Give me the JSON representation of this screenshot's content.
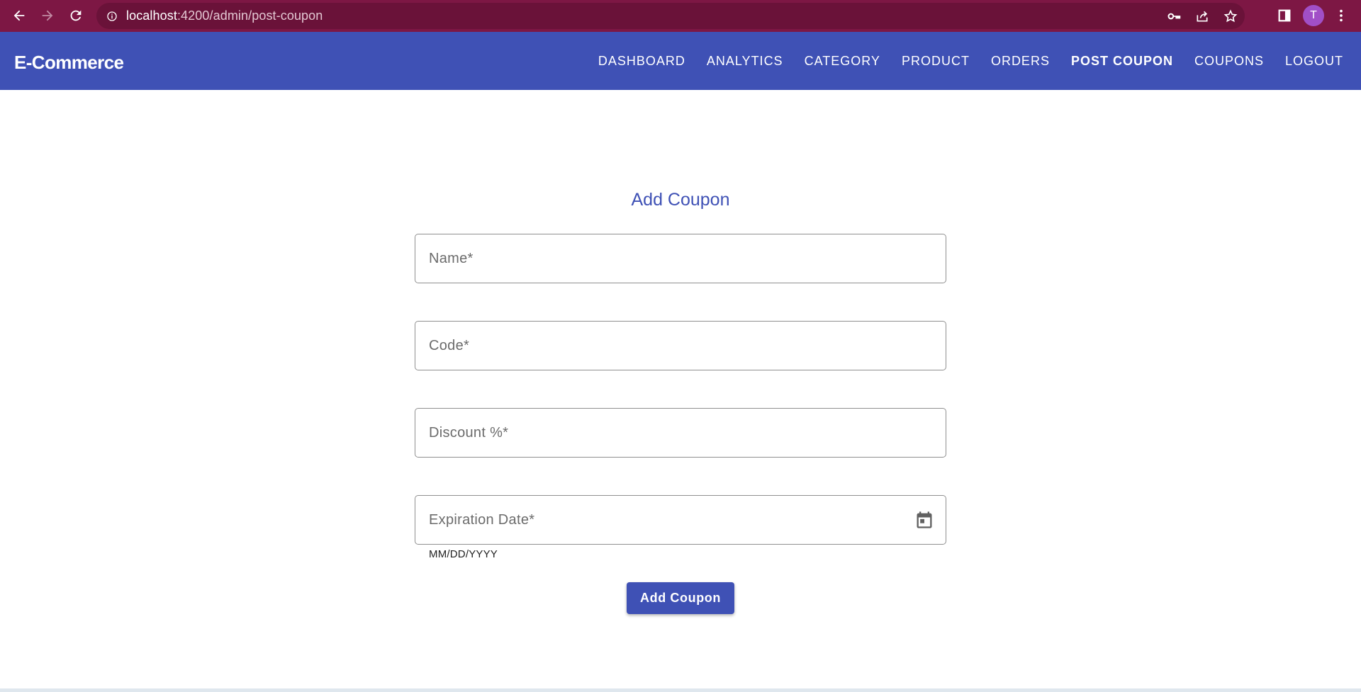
{
  "browser": {
    "url_host": "localhost",
    "url_path": ":4200/admin/post-coupon",
    "profile_initial": "T"
  },
  "app": {
    "brand": "E-Commerce",
    "nav": [
      {
        "label": "DASHBOARD"
      },
      {
        "label": "ANALYTICS"
      },
      {
        "label": "CATEGORY"
      },
      {
        "label": "PRODUCT"
      },
      {
        "label": "ORDERS"
      },
      {
        "label": "POST COUPON",
        "active": true
      },
      {
        "label": "COUPONS"
      },
      {
        "label": "LOGOUT"
      }
    ]
  },
  "form": {
    "title": "Add Coupon",
    "name_placeholder": "Name*",
    "code_placeholder": "Code*",
    "discount_placeholder": "Discount %*",
    "expiration_placeholder": "Expiration Date*",
    "date_hint": "MM/DD/YYYY",
    "submit_label": "Add Coupon"
  },
  "icons": {
    "back": "arrow-back-icon",
    "forward": "arrow-forward-icon",
    "reload": "reload-icon",
    "info": "info-icon",
    "key": "key-icon",
    "share": "share-icon",
    "star": "star-icon",
    "sidepanel": "side-panel-icon",
    "menu": "more-vert-icon",
    "calendar": "calendar-icon"
  },
  "colors": {
    "chrome": "#7d1744",
    "primary": "#3f51b5"
  }
}
